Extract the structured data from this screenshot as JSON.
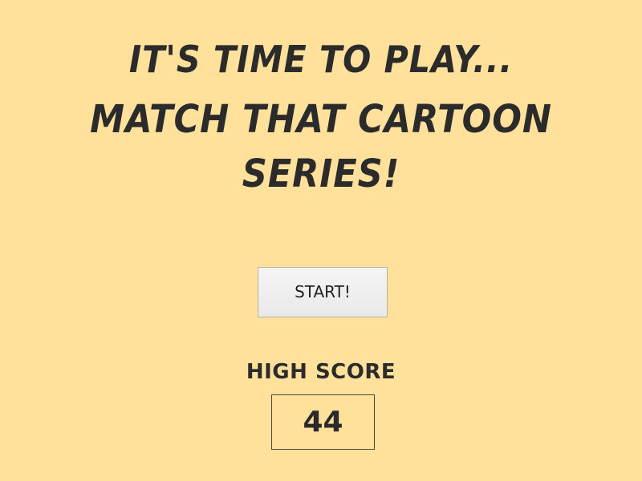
{
  "title": {
    "line1": "IT'S TIME TO PLAY...",
    "line2": "MATCH THAT CARTOON",
    "line3": "SERIES!"
  },
  "start_button": {
    "label": "START!"
  },
  "high_score": {
    "label": "HIGH SCORE",
    "value": "44"
  },
  "colors": {
    "background": "#ffe19c",
    "text": "#2c2b2b",
    "button_bg": "#eeeeee"
  }
}
